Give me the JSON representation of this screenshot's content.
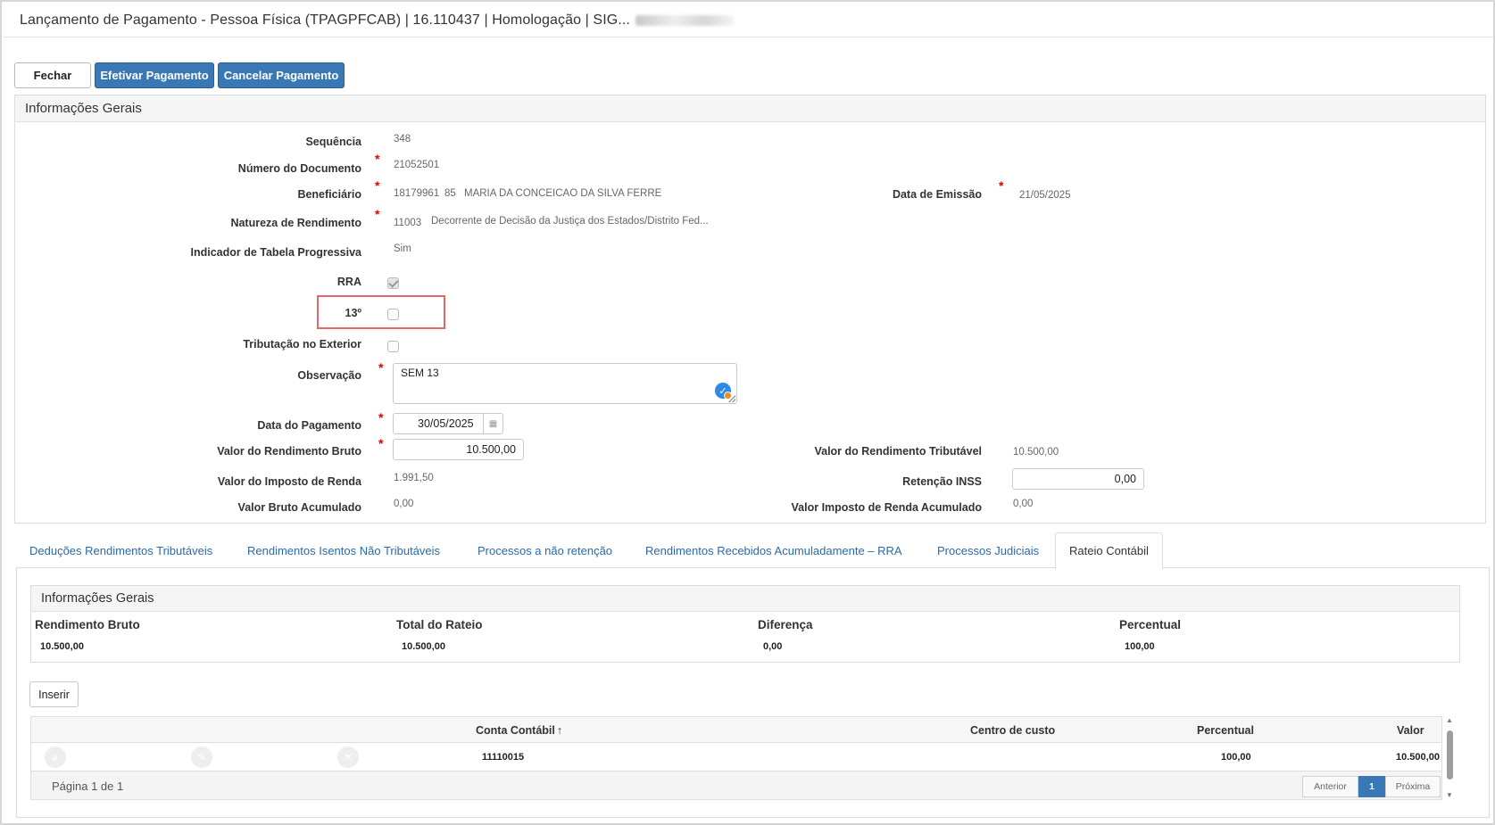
{
  "window": {
    "title": "Lançamento de Pagamento - Pessoa Física (TPAGPFCAB) | 16.110437 | Homologação | SIG..."
  },
  "toolbar": {
    "close_label": "Fechar",
    "pay_label": "Efetivar Pagamento",
    "cancel_label": "Cancelar Pagamento"
  },
  "general": {
    "title": "Informações Gerais",
    "sequencia_label": "Sequência",
    "sequencia_value": "348",
    "numdoc_label": "Número do Documento",
    "numdoc_value": "21052501",
    "beneficiario_label": "Beneficiário",
    "beneficiario_code": "18179961",
    "beneficiario_sub": "85",
    "beneficiario_name": "MARIA DA CONCEICAO DA SILVA FERRE",
    "data_emissao_label": "Data de Emissão",
    "data_emissao_value": "21/05/2025",
    "natureza_label": "Natureza de Rendimento",
    "natureza_code": "11003",
    "natureza_desc": "Decorrente de Decisão da Justiça dos Estados/Distrito Fed...",
    "tabela_label": "Indicador de Tabela Progressiva",
    "tabela_value": "Sim",
    "rra_label": "RRA",
    "decimo_label": "13º",
    "exterior_label": "Tributação no Exterior",
    "obs_label": "Observação",
    "obs_value": "SEM 13",
    "data_pag_label": "Data do Pagamento",
    "data_pag_value": "30/05/2025",
    "rend_bruto_label": "Valor do Rendimento Bruto",
    "rend_bruto_value": "10.500,00",
    "rend_trib_label": "Valor do Rendimento Tributável",
    "rend_trib_value": "10.500,00",
    "ir_label": "Valor do Imposto de Renda",
    "ir_value": "1.991,50",
    "inss_label": "Retenção INSS",
    "inss_value": "0,00",
    "bruto_acum_label": "Valor Bruto Acumulado",
    "bruto_acum_value": "0,00",
    "ir_acum_label": "Valor Imposto de Renda Acumulado",
    "ir_acum_value": "0,00"
  },
  "tabs": [
    {
      "label": "Deduções Rendimentos Tributáveis"
    },
    {
      "label": "Rendimentos Isentos Não Tributáveis"
    },
    {
      "label": "Processos a não retenção"
    },
    {
      "label": "Rendimentos Recebidos Acumuladamente – RRA"
    },
    {
      "label": "Processos Judiciais"
    },
    {
      "label": "Rateio Contábil"
    }
  ],
  "rateio": {
    "title": "Informações Gerais",
    "headers": [
      "Rendimento Bruto",
      "Total do Rateio",
      "Diferença",
      "Percentual"
    ],
    "values": [
      "10.500,00",
      "10.500,00",
      "0,00",
      "100,00"
    ],
    "insert_label": "Inserir"
  },
  "grid": {
    "columns": [
      "Conta Contábil",
      "Centro de custo",
      "Percentual",
      "Valor"
    ],
    "sort_indicator": "↑",
    "rows": [
      {
        "conta": "11110015",
        "centro": "",
        "percentual": "100,00",
        "valor": "10.500,00"
      }
    ],
    "page_info": "Página 1 de 1",
    "prev_label": "Anterior",
    "page_label": "1",
    "next_label": "Próxima"
  }
}
